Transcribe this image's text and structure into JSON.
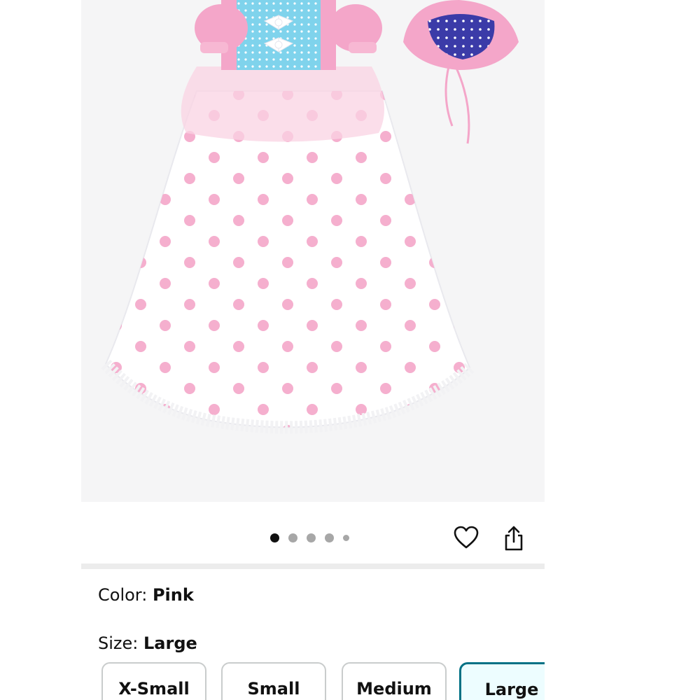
{
  "product": {
    "image_alt": "Pink and white polka dot dress with blue bodice and matching bonnet",
    "carousel": {
      "total_dots": 5,
      "active_index": 0
    },
    "actions": {
      "favorite_icon": "heart-icon",
      "share_icon": "share-icon"
    }
  },
  "variations": {
    "color": {
      "label": "Color:",
      "value": "Pink"
    },
    "size": {
      "label": "Size:",
      "value": "Large"
    },
    "size_options": [
      {
        "label": "X-Small",
        "selected": false
      },
      {
        "label": "Small",
        "selected": false
      },
      {
        "label": "Medium",
        "selected": false
      },
      {
        "label": "Large",
        "selected": true
      }
    ]
  },
  "colors": {
    "selected_border": "#007185",
    "selected_bg": "#edfdff",
    "dress_pink": "#f4a6c9",
    "bodice_blue": "#7fd3ec",
    "bonnet_navy": "#3b3ba8"
  }
}
